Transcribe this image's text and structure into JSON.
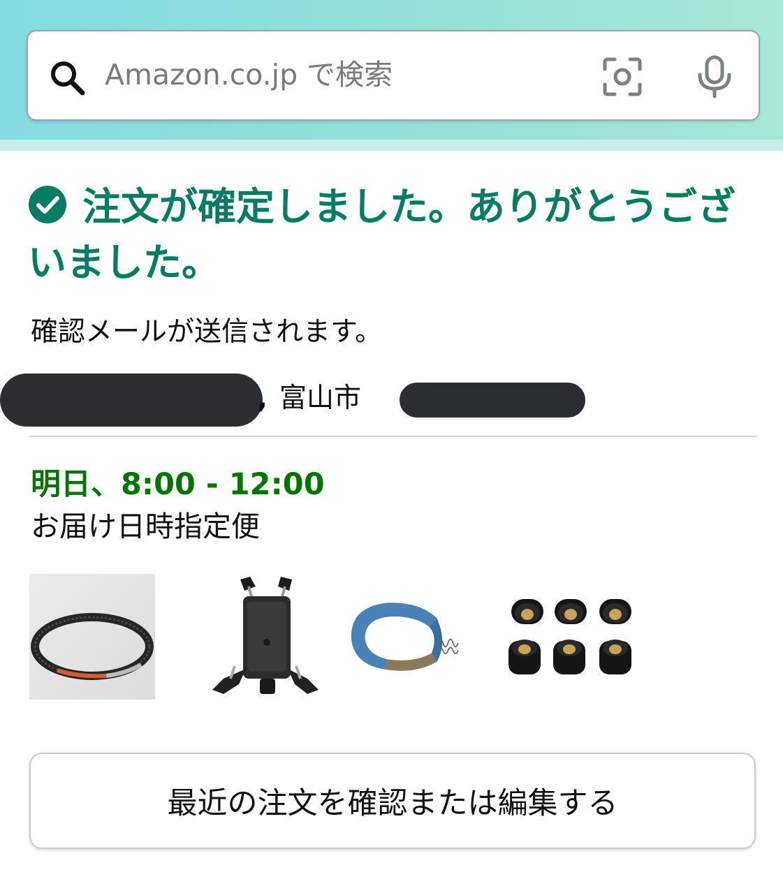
{
  "search": {
    "placeholder": "Amazon.co.jp で検索",
    "icons": [
      "search-icon",
      "camera-icon",
      "microphone-icon"
    ]
  },
  "confirmation": {
    "title": "注文が確定しました。ありがとうございました。",
    "email_note": "確認メールが送信されます。"
  },
  "address": {
    "separator": ",",
    "city": "富山市"
  },
  "delivery": {
    "time": "明日、8:00 - 12:00",
    "method": "お届け日時指定便"
  },
  "items": [
    {
      "name": "drive-belt"
    },
    {
      "name": "phone-holder"
    },
    {
      "name": "brake-shoe"
    },
    {
      "name": "weight-rollers"
    }
  ],
  "actions": {
    "review_orders_label": "最近の注文を確認または編集する"
  },
  "colors": {
    "success_green": "#067d62",
    "delivery_green": "#007600",
    "header_gradient_start": "#84dbe2",
    "header_gradient_end": "#a7e7d6"
  }
}
